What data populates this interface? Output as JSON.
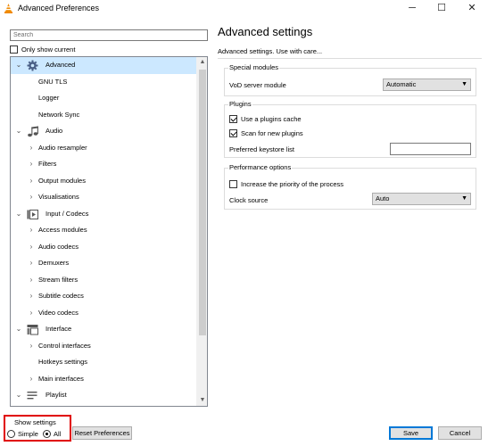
{
  "window": {
    "title": "Advanced Preferences",
    "minimize": "─",
    "maximize": "☐",
    "close": "✕"
  },
  "left": {
    "search_placeholder": "Search",
    "only_current_label": "Only show current",
    "only_current_checked": false,
    "tree": [
      {
        "label": "Advanced",
        "level": 0,
        "expander": "⌄",
        "icon": "gear-icon",
        "selected": true
      },
      {
        "label": "GNU TLS",
        "level": 1,
        "expander": ""
      },
      {
        "label": "Logger",
        "level": 1,
        "expander": ""
      },
      {
        "label": "Network Sync",
        "level": 1,
        "expander": ""
      },
      {
        "label": "Audio",
        "level": 0,
        "expander": "⌄",
        "icon": "music-note-icon"
      },
      {
        "label": "Audio resampler",
        "level": 1,
        "expander": "›"
      },
      {
        "label": "Filters",
        "level": 1,
        "expander": "›"
      },
      {
        "label": "Output modules",
        "level": 1,
        "expander": "›"
      },
      {
        "label": "Visualisations",
        "level": 1,
        "expander": "›"
      },
      {
        "label": "Input / Codecs",
        "level": 0,
        "expander": "⌄",
        "icon": "codec-icon"
      },
      {
        "label": "Access modules",
        "level": 1,
        "expander": "›"
      },
      {
        "label": "Audio codecs",
        "level": 1,
        "expander": "›"
      },
      {
        "label": "Demuxers",
        "level": 1,
        "expander": "›"
      },
      {
        "label": "Stream filters",
        "level": 1,
        "expander": "›"
      },
      {
        "label": "Subtitle codecs",
        "level": 1,
        "expander": "›"
      },
      {
        "label": "Video codecs",
        "level": 1,
        "expander": "›"
      },
      {
        "label": "Interface",
        "level": 0,
        "expander": "⌄",
        "icon": "interface-icon"
      },
      {
        "label": "Control interfaces",
        "level": 1,
        "expander": "›"
      },
      {
        "label": "Hotkeys settings",
        "level": 1,
        "expander": ""
      },
      {
        "label": "Main interfaces",
        "level": 1,
        "expander": "›"
      },
      {
        "label": "Playlist",
        "level": 0,
        "expander": "⌄",
        "icon": "playlist-icon"
      }
    ],
    "show_settings": {
      "title": "Show settings",
      "simple_label": "Simple",
      "all_label": "All",
      "selected": "All"
    },
    "reset_label": "Reset Preferences"
  },
  "right": {
    "title": "Advanced settings",
    "description": "Advanced settings. Use with care...",
    "special_modules": {
      "title": "Special modules",
      "vod_label": "VoD server module",
      "vod_value": "Automatic"
    },
    "plugins": {
      "title": "Plugins",
      "use_cache_label": "Use a plugins cache",
      "use_cache_checked": true,
      "scan_label": "Scan for new plugins",
      "scan_checked": true,
      "keystore_label": "Preferred keystore list",
      "keystore_value": ""
    },
    "performance": {
      "title": "Performance options",
      "priority_label": "Increase the priority of the process",
      "priority_checked": false,
      "clock_label": "Clock source",
      "clock_value": "Auto"
    }
  },
  "footer": {
    "save_label": "Save",
    "cancel_label": "Cancel"
  }
}
